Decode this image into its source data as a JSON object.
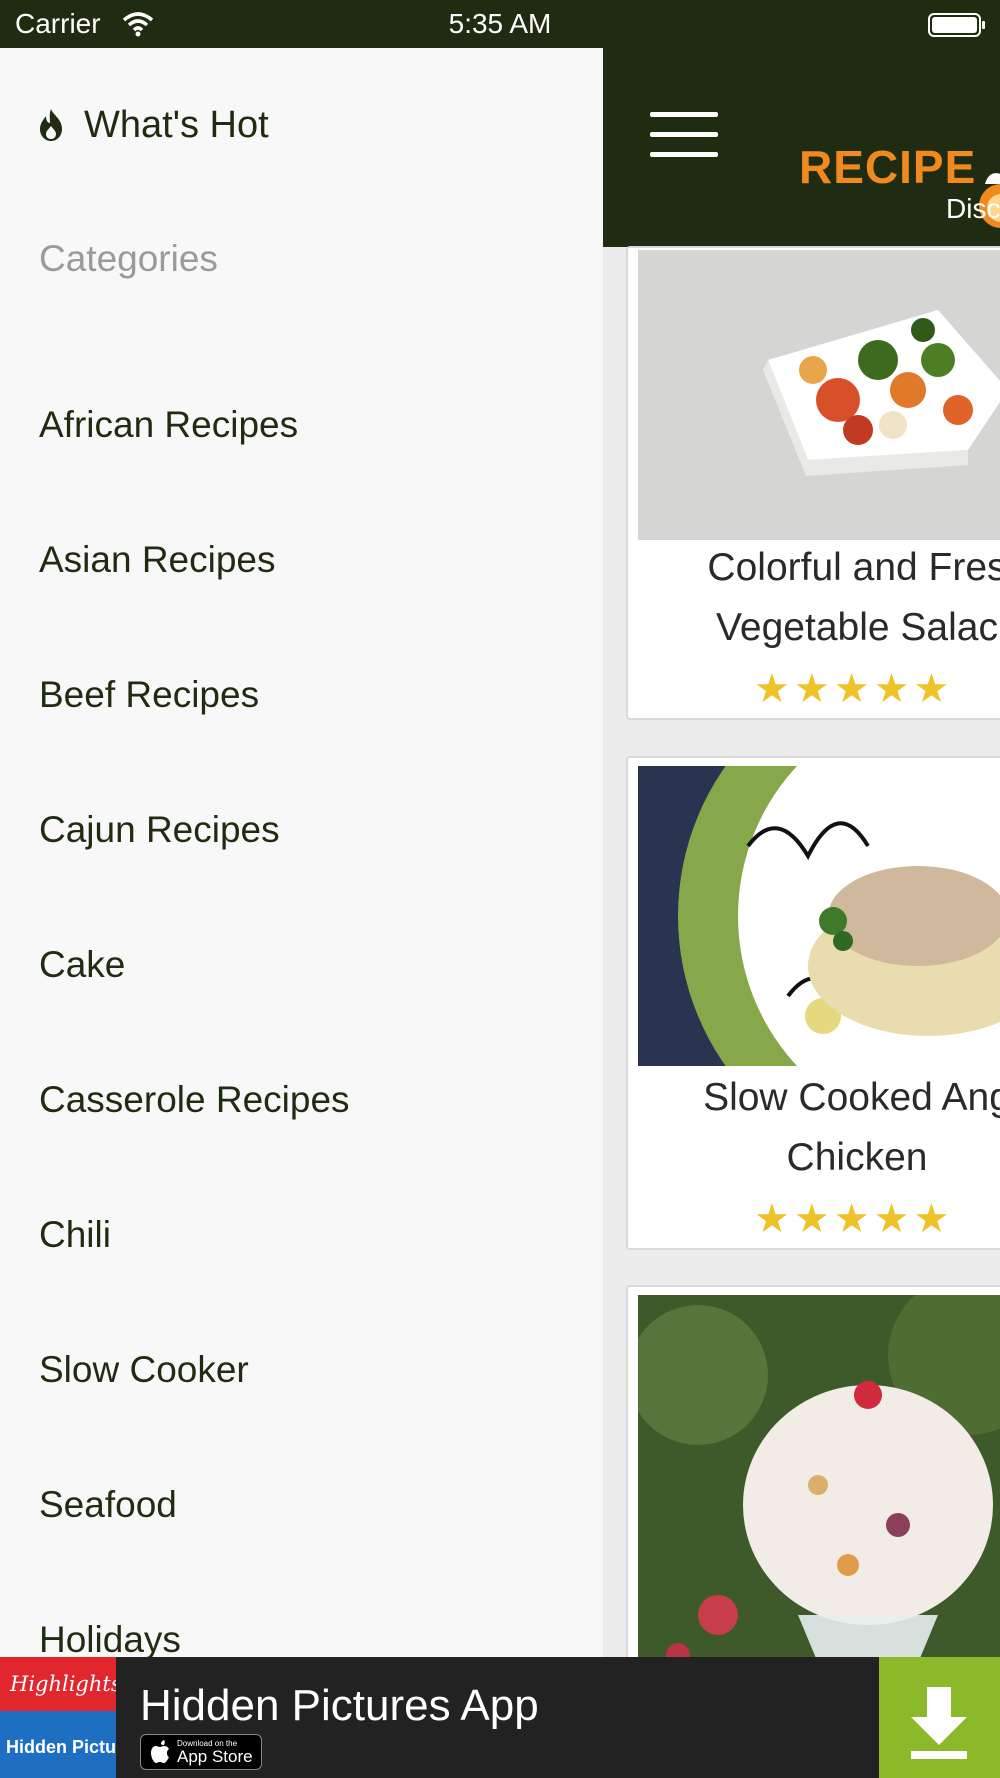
{
  "status_bar": {
    "carrier": "Carrier",
    "time": "5:35 AM"
  },
  "drawer": {
    "whats_hot": "What's Hot",
    "categories_heading": "Categories",
    "categories": [
      "African Recipes",
      "Asian Recipes",
      "Beef Recipes",
      "Cajun Recipes",
      "Cake",
      "Casserole Recipes",
      "Chili",
      "Slow Cooker",
      "Seafood",
      "Holidays"
    ]
  },
  "header": {
    "logo_text": "RECIPE",
    "logo_sub": "Disc"
  },
  "recipes": [
    {
      "title_line1": "Colorful and Fres",
      "title_line2": "Vegetable Salac",
      "rating": "★★★★★"
    },
    {
      "title_line1": "Slow Cooked Ang",
      "title_line2": "Chicken",
      "rating": "★★★★★"
    }
  ],
  "ad": {
    "brand": "Highlights",
    "brand_sub": "Hidden Pictures",
    "headline": "Hidden Pictures App",
    "badge_small": "Download on the",
    "badge_big": "App Store"
  },
  "colors": {
    "header_green": "#1f2c11",
    "logo_orange": "#f08a1e",
    "star_yellow": "#efc22a",
    "download_green": "#8cb92a"
  }
}
